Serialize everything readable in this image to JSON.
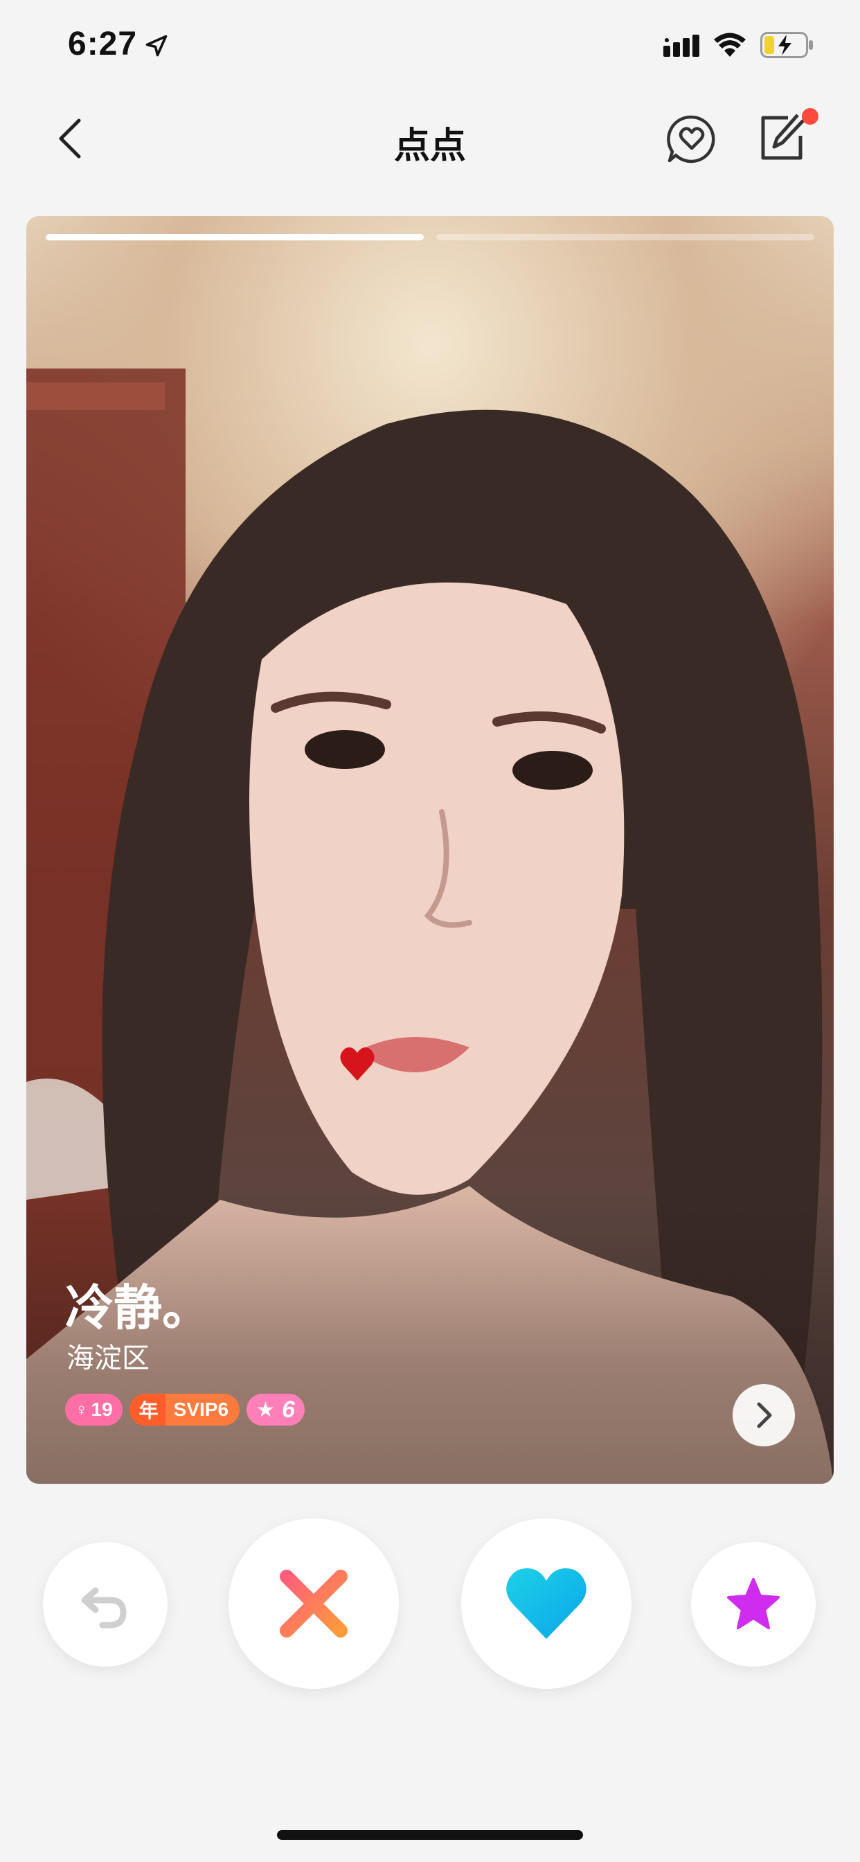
{
  "status_bar": {
    "time": "6:27"
  },
  "nav": {
    "title": "点点"
  },
  "card": {
    "photo_count": 2,
    "current_photo_index": 0,
    "name": "冷静。",
    "location": "海淀区",
    "badges": {
      "age_symbol": "♀",
      "age": "19",
      "svip_year_label": "年",
      "svip_label": "SVIP6",
      "star_symbol": "★",
      "star_level": "6"
    }
  },
  "actions": {
    "undo": "undo-icon",
    "pass": "close-x-icon",
    "like": "heart-icon",
    "superlike": "star-icon"
  },
  "colors": {
    "notification_dot": "#ff4a3d",
    "pass_gradient": [
      "#ff5e7a",
      "#ff9a3d"
    ],
    "like_gradient": [
      "#1ed0e8",
      "#0aa6e8"
    ],
    "superlike": "#d02cf0",
    "age_badge": "#ff6fa5",
    "svip_badge": "#ff7a3c",
    "star_badge": "#ff7fb8"
  }
}
